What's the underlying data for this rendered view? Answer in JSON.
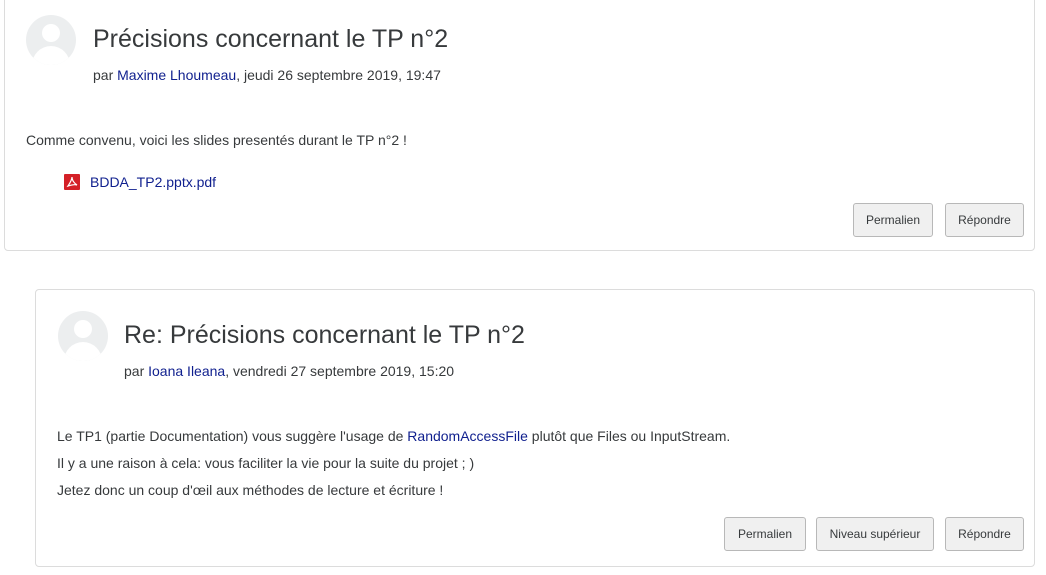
{
  "posts": [
    {
      "subject": "Précisions concernant le TP n°2",
      "by_prefix": "par",
      "author": "Maxime Lhoumeau",
      "date": ", jeudi 26 septembre 2019, 19:47",
      "message": "Comme convenu, voici les slides presentés durant le TP n°2 !",
      "attachment": {
        "name": "BDDA_TP2.pptx.pdf",
        "icon": "pdf-icon"
      },
      "actions": {
        "permalink": "Permalien",
        "reply": "Répondre"
      }
    },
    {
      "subject": "Re: Précisions concernant le TP n°2",
      "by_prefix": "par",
      "author": "Ioana Ileana",
      "date": ", vendredi 27 septembre 2019, 15:20",
      "message_line1_before": "Le TP1 (partie Documentation) vous suggère l'usage de ",
      "message_line1_link": "RandomAccessFile",
      "message_line1_after": " plutôt que Files ou InputStream.",
      "message_line2": "Il y a une raison à cela: vous faciliter la vie pour la suite du projet ; )",
      "message_line3": "Jetez donc un coup d'œil aux méthodes de lecture et écriture !",
      "actions": {
        "permalink": "Permalien",
        "parent": "Niveau supérieur",
        "reply": "Répondre"
      }
    }
  ],
  "colors": {
    "link": "#0f1f8e",
    "text": "#373a3c",
    "border": "#dcdcdc",
    "button_bg": "#f0f0f0"
  }
}
